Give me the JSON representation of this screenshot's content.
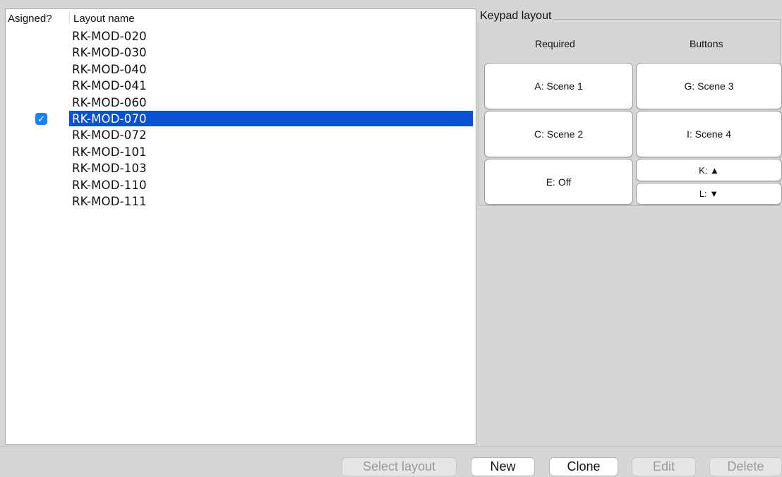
{
  "table": {
    "headers": {
      "assigned": "Asigned?",
      "layout_name": "Layout name"
    },
    "rows": [
      {
        "name": "RK-MOD-020",
        "assigned": false,
        "selected": false
      },
      {
        "name": "RK-MOD-030",
        "assigned": false,
        "selected": false
      },
      {
        "name": "RK-MOD-040",
        "assigned": false,
        "selected": false
      },
      {
        "name": "RK-MOD-041",
        "assigned": false,
        "selected": false
      },
      {
        "name": "RK-MOD-060",
        "assigned": false,
        "selected": false
      },
      {
        "name": "RK-MOD-070",
        "assigned": true,
        "selected": true
      },
      {
        "name": "RK-MOD-072",
        "assigned": false,
        "selected": false
      },
      {
        "name": "RK-MOD-101",
        "assigned": false,
        "selected": false
      },
      {
        "name": "RK-MOD-103",
        "assigned": false,
        "selected": false
      },
      {
        "name": "RK-MOD-110",
        "assigned": false,
        "selected": false
      },
      {
        "name": "RK-MOD-111",
        "assigned": false,
        "selected": false
      }
    ]
  },
  "keypad": {
    "title": "Keypad layout",
    "col_required": "Required",
    "col_buttons": "Buttons",
    "buttons": {
      "a": "A: Scene 1",
      "g": "G: Scene 3",
      "c": "C: Scene 2",
      "i": "I: Scene 4",
      "e": "E: Off",
      "k": "K: ▲",
      "l": "L: ▼"
    }
  },
  "actions": {
    "select_layout": "Select layout",
    "new": "New",
    "clone": "Clone",
    "edit": "Edit",
    "delete": "Delete"
  },
  "colors": {
    "selection": "#0b4fd3",
    "checkbox": "#1a82f7",
    "window_bg": "#d6d6d6"
  }
}
